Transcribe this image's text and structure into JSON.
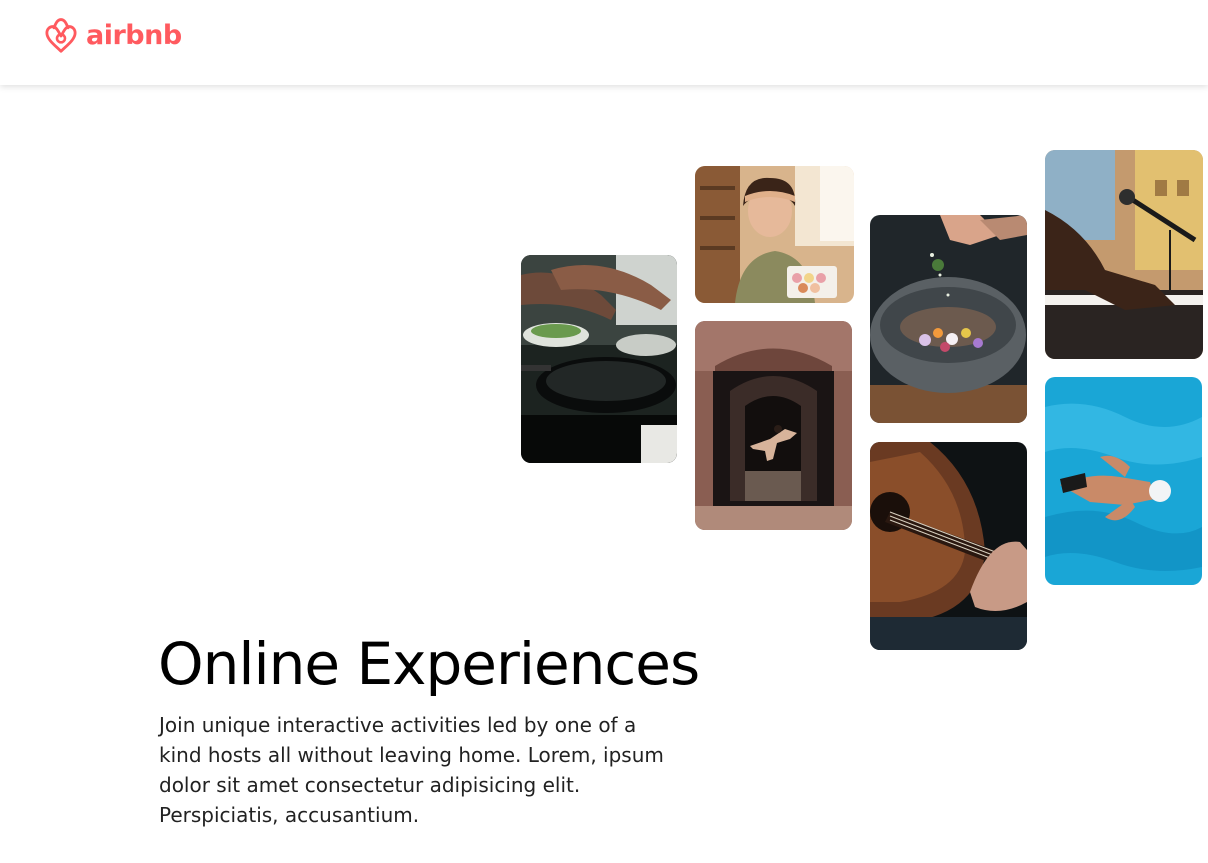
{
  "brand": {
    "name": "airbnb",
    "color": "#FF5A5F"
  },
  "hero": {
    "title": "Online Experiences",
    "description": "Join unique interactive activities led by one of a kind hosts all without leaving home. Lorem, ipsum dolor sit amet consectetur adipisicing elit. Perspiciatis, accusantium."
  },
  "gallery": [
    {
      "subject": "hands cooking with pans"
    },
    {
      "subject": "woman holding a box of macarons"
    },
    {
      "subject": "dancer leaping in an archway"
    },
    {
      "subject": "chef sprinkling food into a stone bowl"
    },
    {
      "subject": "hands playing an acoustic guitar"
    },
    {
      "subject": "hands playing a keyboard by a microphone"
    },
    {
      "subject": "swimmer in a pool"
    }
  ]
}
